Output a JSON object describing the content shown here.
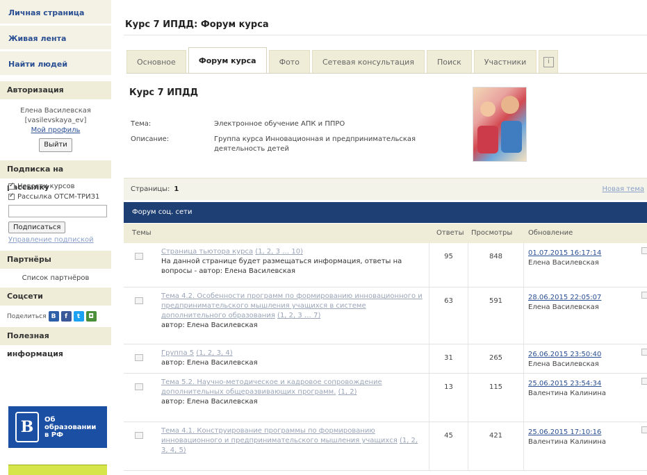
{
  "sidebar": {
    "nav": [
      "Личная страница",
      "Живая лента",
      "Найти людей"
    ],
    "auth": {
      "heading": "Авторизация",
      "name": "Елена Василевская",
      "login": "[vasilevskaya_ev]",
      "profile_link": "Мой профиль",
      "logout": "Выйти"
    },
    "subscription": {
      "heading": "Подписка на рассылку",
      "items": [
        "Новости курсов",
        "Рассылка ОТСМ-ТРИЗ1"
      ],
      "subscribe_button": "Подписаться",
      "manage_link": "Управление подпиской"
    },
    "partners": {
      "heading": "Партнёры",
      "list_link": "Список партнёров"
    },
    "social": {
      "heading": "Соцсети",
      "share_label": "Поделиться"
    },
    "useful": {
      "heading": "Полезная информация"
    },
    "banner": {
      "line1": "Об",
      "line2": "образовании",
      "line3": "в РФ",
      "logo_letter": "В"
    }
  },
  "main": {
    "page_title": "Курс 7 ИПДД: Форум курса",
    "tabs": [
      "Основное",
      "Форум курса",
      "Фото",
      "Сетевая консультация",
      "Поиск",
      "Участники"
    ],
    "active_tab": "Форум курса",
    "course_title": "Курс 7 ИПДД",
    "meta": {
      "theme_label": "Тема:",
      "theme_value": "Электронное обучение АПК и ППРО",
      "desc_label": "Описание:",
      "desc_value": "Группа курса Инновационная и предпринимательская деятельность детей"
    },
    "pages_label": "Страницы:",
    "pages_value": "1",
    "new_topic": "Новая тема",
    "forum_name": "Форум соц. сети",
    "columns": {
      "topics": "Темы",
      "answers": "Ответы",
      "views": "Просмотры",
      "updated": "Обновление"
    },
    "rows": [
      {
        "title": "Страница тьютора курса",
        "pages": "(1, 2, 3 … 10)",
        "desc": "На данной странице будет размещаться информация, ответы на вопросы - автор: Елена Василевская",
        "answers": "95",
        "views": "848",
        "date": "01.07.2015 16:17:14",
        "user": "Елена Василевская"
      },
      {
        "title": "Тема 4.2. Особенности программ по формированию инновационного и предпринимательского мышления учащихся в системе дополнительного образования",
        "pages": "(1, 2, 3 … 7)",
        "desc": "автор: Елена Василевская",
        "answers": "63",
        "views": "591",
        "date": "28.06.2015 22:05:07",
        "user": "Елена Василевская"
      },
      {
        "title": "Группа 5",
        "pages": "(1, 2, 3, 4)",
        "desc": "автор: Елена Василевская",
        "answers": "31",
        "views": "265",
        "date": "26.06.2015 23:50:40",
        "user": "Елена Василевская"
      },
      {
        "title": "Тема 5.2. Научно-методическое и кадровое сопровождение дополнительных общеразвивающих программ.",
        "pages": "(1, 2)",
        "desc": "автор: Елена Василевская",
        "answers": "13",
        "views": "115",
        "date": "25.06.2015 23:54:34",
        "user": "Валентина Калинина"
      },
      {
        "title": "Тема 4.1. Конструирование программы по формированию инновационного и предпринимательского мышления учащихся",
        "pages": "(1, 2, 3, 4, 5)",
        "desc": "",
        "answers": "45",
        "views": "421",
        "date": "25.06.2015 17:10:16",
        "user": "Валентина Калинина"
      }
    ]
  },
  "colors": {
    "nav_link": "#2a4f93",
    "forum_header": "#1e3f73",
    "tab_bg": "#efedd8",
    "banner": "#1b4fa3"
  }
}
